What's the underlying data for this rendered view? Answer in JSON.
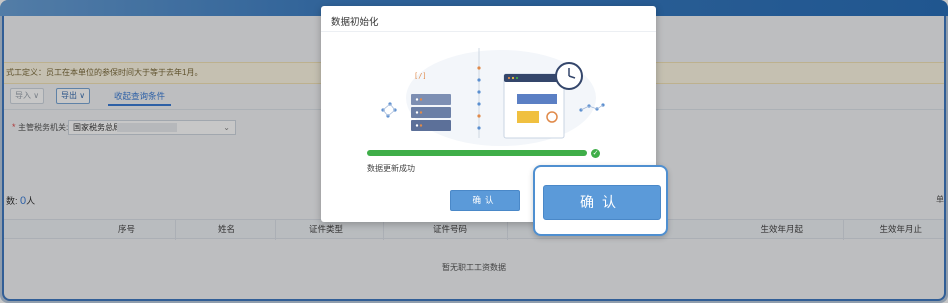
{
  "page": {
    "notice": "式工定义：员工在本单位的参保时间大于等于去年1月。",
    "toolbar": {
      "import_label": "导入 ∨",
      "export_label": "导出 ∨",
      "toggle_label": "收起查询条件"
    },
    "filter": {
      "required_mark": "*",
      "label": "主管税务机关:",
      "value": "国家税务总局"
    },
    "count": {
      "prefix": "数:",
      "number": "0",
      "unit": "人"
    },
    "count_right": "单",
    "grid": {
      "columns": [
        "序号",
        "姓名",
        "证件类型",
        "证件号码",
        "生效年月起",
        "生效年月止"
      ],
      "empty_message": "暂无职工工资数据"
    }
  },
  "modal": {
    "title": "数据初始化",
    "code_glyph": "[/]",
    "progress_percent": 100,
    "status": "数据更新成功",
    "confirm_label": "确认",
    "accent_color": "#5b9ad9",
    "success_color": "#3fae49"
  },
  "callout": {
    "confirm_label": "确认"
  }
}
